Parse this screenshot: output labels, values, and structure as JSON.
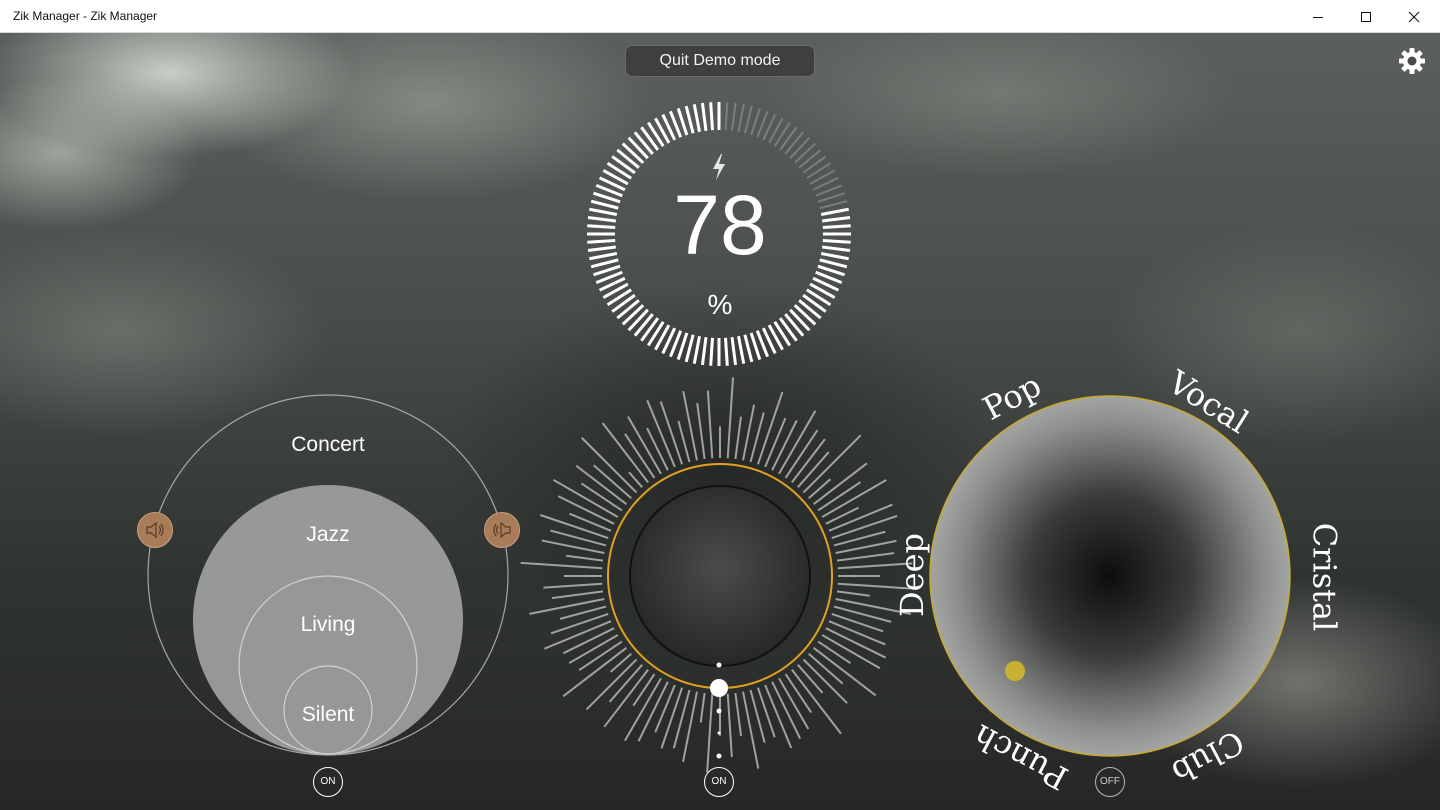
{
  "window": {
    "title": "Zik Manager - Zik Manager",
    "minimize_icon": "minimize-icon",
    "maximize_icon": "maximize-icon",
    "close_icon": "close-icon"
  },
  "header": {
    "quit_demo_label": "Quit Demo mode",
    "settings_icon": "gear-icon"
  },
  "battery": {
    "value": "78",
    "unit": "%",
    "charging_icon": "lightning-icon",
    "level_fraction": 0.78
  },
  "sound_effect": {
    "modes": [
      "Concert",
      "Jazz",
      "Living",
      "Silent"
    ],
    "toggle_label": "ON",
    "speaker_icon": "speaker-icon"
  },
  "noise_control": {
    "toggle_label": "ON",
    "accent_color": "#e0a020"
  },
  "equalizer": {
    "presets": [
      "Pop",
      "Vocal",
      "Cristal",
      "Club",
      "Punch",
      "Deep"
    ],
    "toggle_label": "OFF",
    "accent_color": "#c8b030"
  }
}
